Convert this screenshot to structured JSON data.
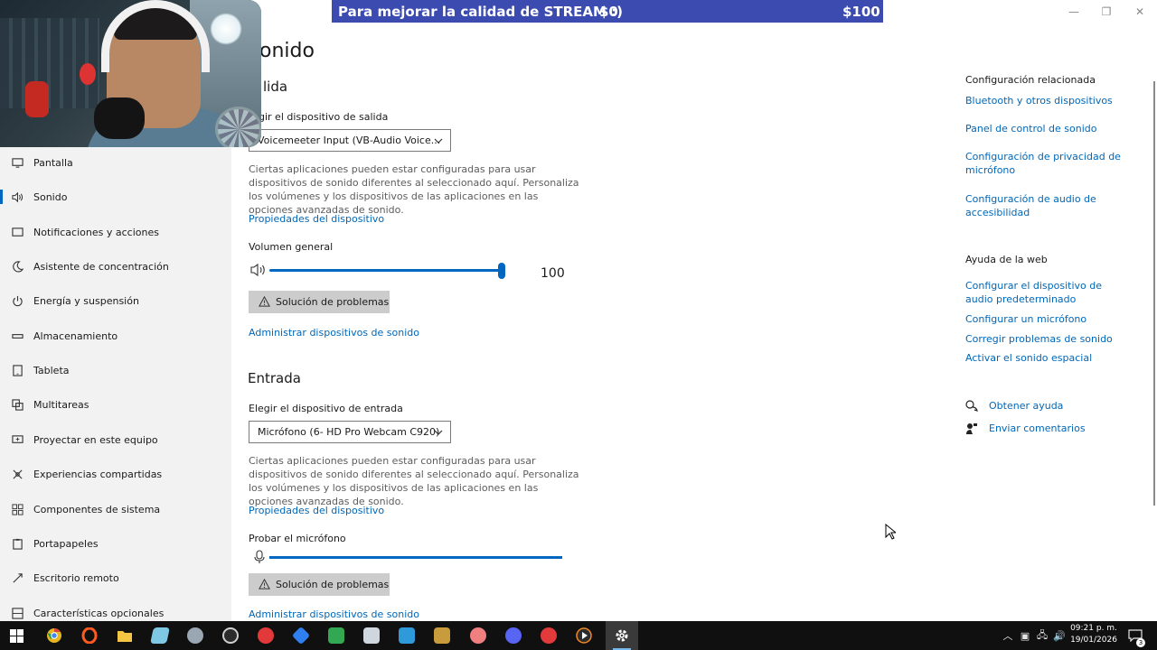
{
  "banner": {
    "text": "Para mejorar la calidad de STREAM :)",
    "min": "$0",
    "max": "$100"
  },
  "window_controls": {
    "minimize": "—",
    "maximize": "❐",
    "close": "✕"
  },
  "sidebar": {
    "items": [
      {
        "label": "Pantalla",
        "icon": "monitor-icon",
        "active": false
      },
      {
        "label": "Sonido",
        "icon": "speaker-icon",
        "active": true
      },
      {
        "label": "Notificaciones y acciones",
        "icon": "notification-icon",
        "active": false
      },
      {
        "label": "Asistente de concentración",
        "icon": "moon-icon",
        "active": false
      },
      {
        "label": "Energía y suspensión",
        "icon": "power-icon",
        "active": false
      },
      {
        "label": "Almacenamiento",
        "icon": "storage-icon",
        "active": false
      },
      {
        "label": "Tableta",
        "icon": "tablet-icon",
        "active": false
      },
      {
        "label": "Multitareas",
        "icon": "multitask-icon",
        "active": false
      },
      {
        "label": "Proyectar en este equipo",
        "icon": "project-icon",
        "active": false
      },
      {
        "label": "Experiencias compartidas",
        "icon": "shared-icon",
        "active": false
      },
      {
        "label": "Componentes de sistema",
        "icon": "components-icon",
        "active": false
      },
      {
        "label": "Portapapeles",
        "icon": "clipboard-icon",
        "active": false
      },
      {
        "label": "Escritorio remoto",
        "icon": "remote-desktop-icon",
        "active": false
      },
      {
        "label": "Características opcionales",
        "icon": "optional-features-icon",
        "active": false
      }
    ]
  },
  "main": {
    "title": "onido",
    "output": {
      "title": "lida",
      "choose_label": "gir el dispositivo de salida",
      "device": "Voicemeeter Input (VB-Audio Voice...",
      "description": "Ciertas aplicaciones pueden estar configuradas para usar dispositivos de sonido diferentes al seleccionado aquí. Personaliza los volúmenes y los dispositivos de las aplicaciones en las opciones avanzadas de sonido.",
      "properties_link": "Propiedades del dispositivo",
      "volume_label": "Volumen general",
      "volume_value": "100",
      "volume_level": 1.0,
      "troubleshoot": "Solución de problemas",
      "manage_link": "Administrar dispositivos de sonido"
    },
    "input": {
      "title": "Entrada",
      "choose_label": "Elegir el dispositivo de entrada",
      "device": "Micrófono (6- HD Pro Webcam C920)",
      "description": "Ciertas aplicaciones pueden estar configuradas para usar dispositivos de sonido diferentes al seleccionado aquí. Personaliza los volúmenes y los dispositivos de las aplicaciones en las opciones avanzadas de sonido.",
      "properties_link": "Propiedades del dispositivo",
      "test_label": "Probar el micrófono",
      "troubleshoot": "Solución de problemas",
      "manage_link": "Administrar dispositivos de sonido"
    }
  },
  "related": {
    "title": "Configuración relacionada",
    "links": [
      "Bluetooth y otros dispositivos",
      "Panel de control de sonido",
      "Configuración de privacidad de micrófono",
      "Configuración de audio de accesibilidad"
    ]
  },
  "web_help": {
    "title": "Ayuda de la web",
    "links": [
      "Configurar el dispositivo de audio predeterminado",
      "Configurar un micrófono",
      "Corregir problemas de sonido",
      "Activar el sonido espacial"
    ]
  },
  "help": {
    "get_help": "Obtener ayuda",
    "feedback": "Enviar comentarios"
  },
  "taskbar": {
    "time": "09:21 p. m.",
    "date": "19/01/2026",
    "notification_count": "3",
    "accent": "#76b9ed",
    "apps": [
      {
        "icon": "windows-start-icon",
        "color": "#4aa3f0"
      },
      {
        "icon": "chrome-icon",
        "color": "#e4b421"
      },
      {
        "icon": "opera-icon",
        "color": "#ff5a1f"
      },
      {
        "icon": "file-explorer-icon",
        "color": "#f4c542"
      },
      {
        "icon": "app-icon",
        "color": "#7ec8e3"
      },
      {
        "icon": "app-icon",
        "color": "#9aa7b3"
      },
      {
        "icon": "app-icon",
        "color": "#e23a3a"
      },
      {
        "icon": "app-icon",
        "color": "#e23a3a"
      },
      {
        "icon": "app-icon",
        "color": "#2f7ff0"
      },
      {
        "icon": "app-icon",
        "color": "#32a852"
      },
      {
        "icon": "app-icon",
        "color": "#cfd6dd"
      },
      {
        "icon": "app-icon",
        "color": "#2f9ad9"
      },
      {
        "icon": "app-icon",
        "color": "#c89b3c"
      },
      {
        "icon": "app-icon",
        "color": "#f08080"
      },
      {
        "icon": "discord-icon",
        "color": "#5865f2"
      },
      {
        "icon": "app-icon",
        "color": "#e23a3a"
      },
      {
        "icon": "media-player-icon",
        "color": "#f08a24"
      },
      {
        "icon": "settings-icon",
        "color": "#dddddd"
      }
    ]
  }
}
